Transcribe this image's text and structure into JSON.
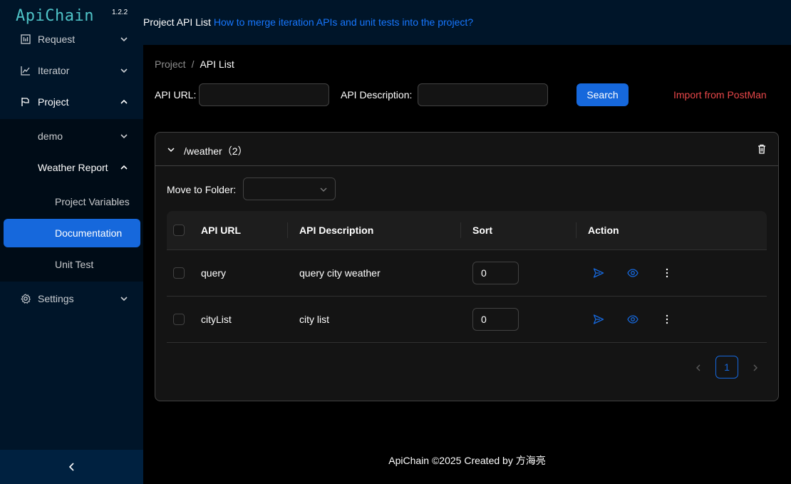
{
  "app": {
    "name": "ApiChain",
    "version": "1.2.2"
  },
  "sidebar": {
    "items": [
      {
        "label": "Request",
        "icon": "bar-chart-icon"
      },
      {
        "label": "Iterator",
        "icon": "line-chart-icon"
      },
      {
        "label": "Project",
        "icon": "flag-icon"
      },
      {
        "label": "demo"
      },
      {
        "label": "Weather Report"
      },
      {
        "label": "Project Variables"
      },
      {
        "label": "Documentation"
      },
      {
        "label": "Unit Test"
      },
      {
        "label": "Settings",
        "icon": "gear-icon"
      }
    ]
  },
  "header": {
    "title": "Project API List",
    "link": "How to merge iteration APIs and unit tests into the project?"
  },
  "breadcrumb": {
    "parent": "Project",
    "sep": "/",
    "current": "API List"
  },
  "filters": {
    "api_url_label": "API URL:",
    "api_desc_label": "API Description:",
    "search_label": "Search",
    "import_label": "Import from PostMan"
  },
  "folder": {
    "title": "/weather（2）",
    "move_label": "Move to Folder:"
  },
  "table": {
    "headers": [
      "API URL",
      "API Description",
      "Sort",
      "Action"
    ],
    "rows": [
      {
        "url": "query",
        "description": "query city weather",
        "sort": "0"
      },
      {
        "url": "cityList",
        "description": "city list",
        "sort": "0"
      }
    ]
  },
  "pagination": {
    "current": "1"
  },
  "footer": "ApiChain ©2025 Created by 方海亮",
  "colors": {
    "primary": "#1668dc",
    "danger": "#e84749",
    "sidebar": "#001529",
    "logo": "#4fc3c7"
  }
}
